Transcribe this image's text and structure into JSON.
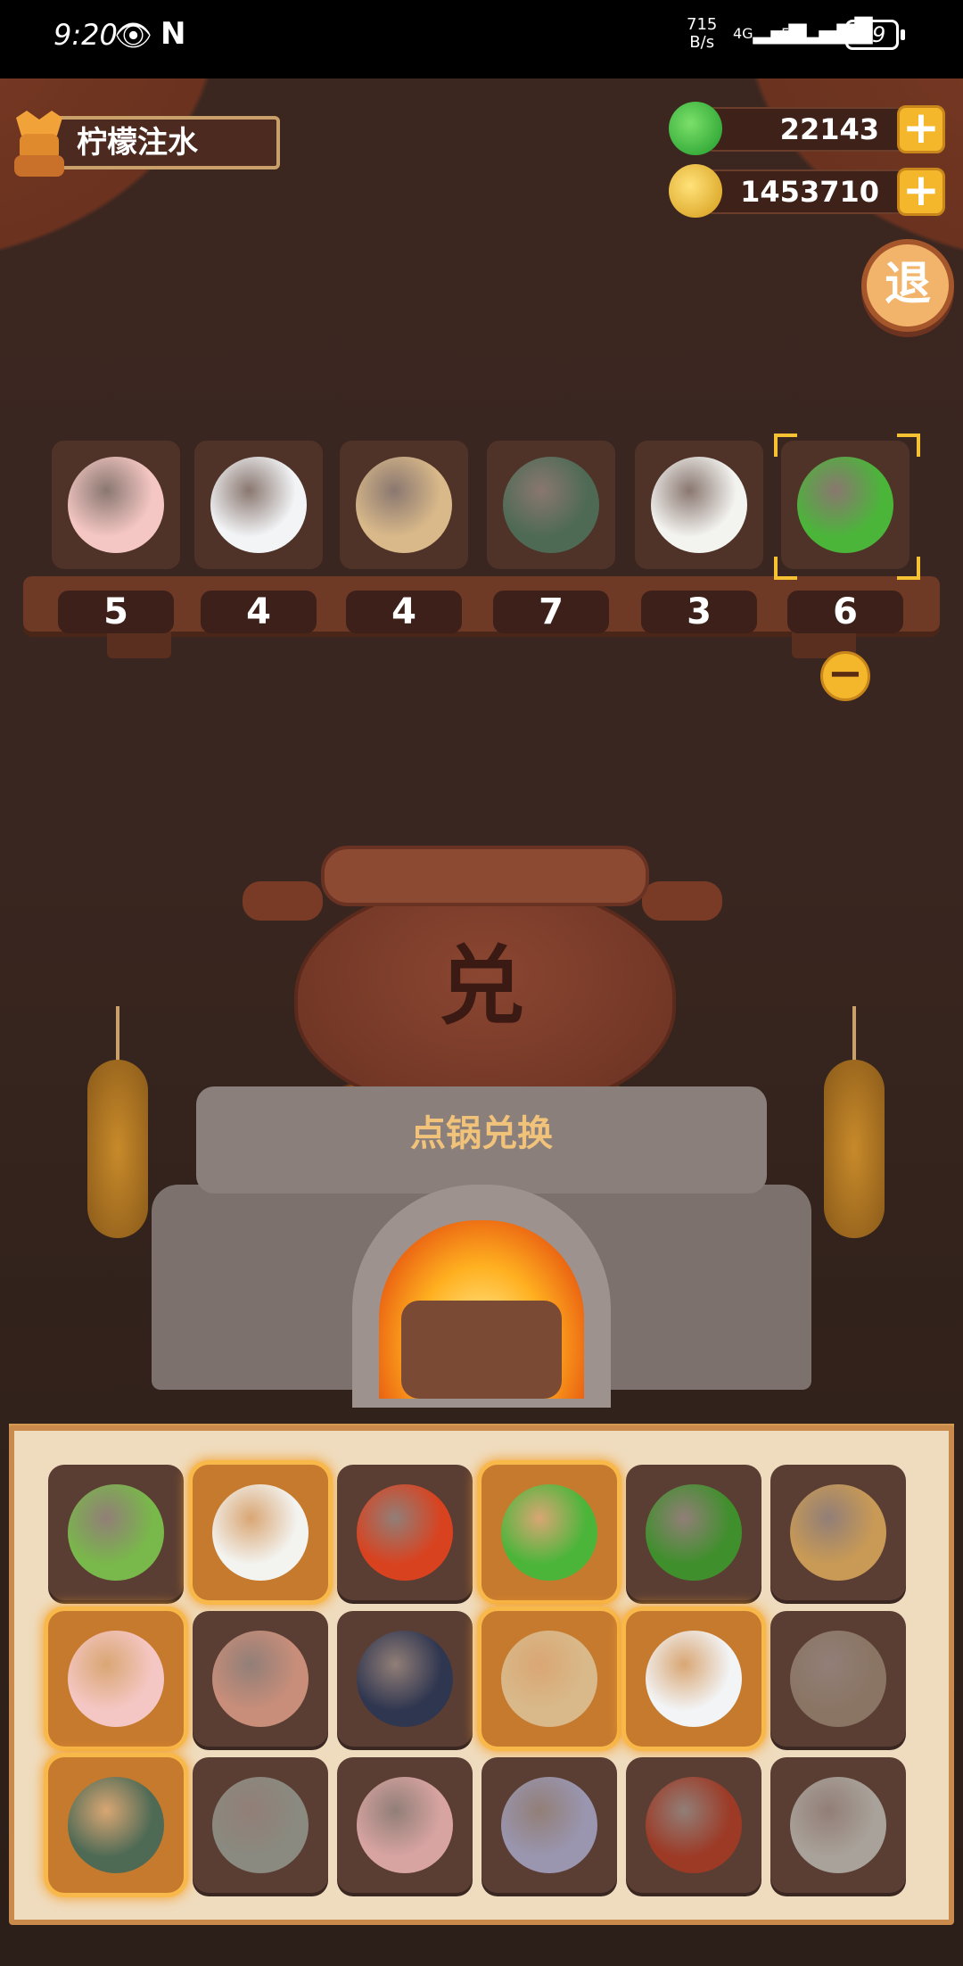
{
  "status": {
    "time": "9:20",
    "speed_value": "715",
    "speed_unit": "B/s",
    "net1": "4G",
    "net2": "5G",
    "battery": "69"
  },
  "player": {
    "name": "柠檬注水"
  },
  "currency": {
    "jade": "22143",
    "coins": "1453710",
    "plus": "+"
  },
  "exit_label": "退",
  "shelf": [
    {
      "item": "chicken",
      "count": "5",
      "color": "#f5c7c4"
    },
    {
      "item": "rice-bowl",
      "count": "4",
      "color": "#f2f4f6"
    },
    {
      "item": "flour-sack",
      "count": "4",
      "color": "#d9b98a"
    },
    {
      "item": "crab",
      "count": "7",
      "color": "#4e6a55"
    },
    {
      "item": "tofu",
      "count": "3",
      "color": "#f3f3f0"
    },
    {
      "item": "cucumber",
      "count": "6",
      "color": "#4bb53a",
      "selected": true
    }
  ],
  "minus_label": "−",
  "pot_glyph": "兑",
  "stove_label": "点锅兑换",
  "inventory": [
    {
      "item": "leek",
      "color": "#79b84a",
      "selected": false
    },
    {
      "item": "tofu",
      "color": "#f3f3f0",
      "selected": true
    },
    {
      "item": "tomato",
      "color": "#d9421f",
      "selected": false
    },
    {
      "item": "cucumber",
      "color": "#4bb53a",
      "selected": true
    },
    {
      "item": "green-pepper",
      "color": "#3f8f2c",
      "selected": false
    },
    {
      "item": "potato",
      "color": "#c99a55",
      "selected": false
    },
    {
      "item": "chicken",
      "color": "#f5c7c4",
      "selected": true
    },
    {
      "item": "egg",
      "color": "#c98e7a",
      "selected": false
    },
    {
      "item": "fish",
      "color": "#2f3650",
      "selected": false
    },
    {
      "item": "flour-sack",
      "color": "#d9b98a",
      "selected": true
    },
    {
      "item": "rice-bowl",
      "color": "#f2f4f6",
      "selected": true
    },
    {
      "item": "jar",
      "color": "#8a7564",
      "selected": false
    },
    {
      "item": "crab",
      "color": "#4e6a55",
      "selected": true
    },
    {
      "item": "shrimp",
      "color": "#8a8a80",
      "selected": false
    },
    {
      "item": "duck",
      "color": "#d8a4a2",
      "selected": false
    },
    {
      "item": "squid",
      "color": "#9a96b0",
      "selected": false
    },
    {
      "item": "meat",
      "color": "#9c3a26",
      "selected": false
    },
    {
      "item": "clam",
      "color": "#a9a29a",
      "selected": false
    }
  ]
}
